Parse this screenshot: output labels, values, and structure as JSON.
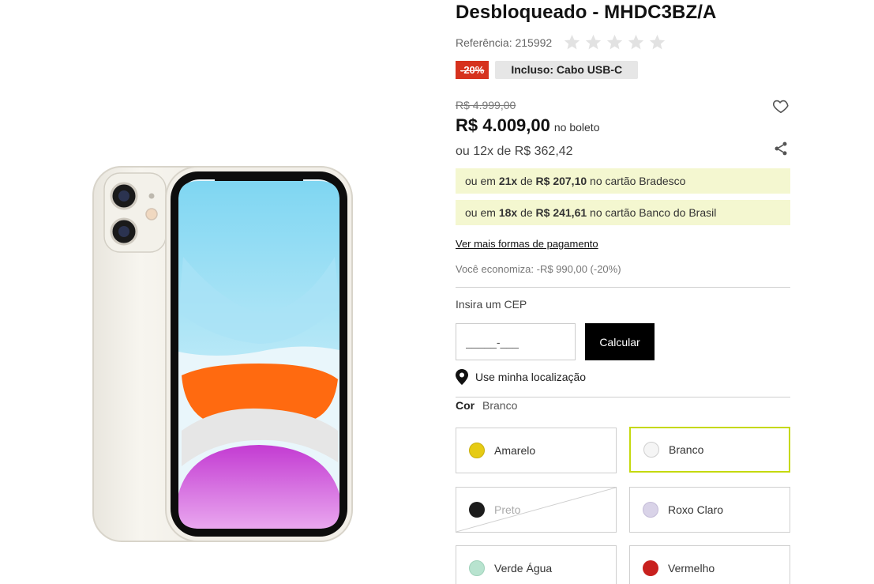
{
  "product": {
    "title": "Desbloqueado - MHDC3BZ/A",
    "reference": "Referência: 215992",
    "rating_stars": 5,
    "rating_filled": 0
  },
  "badges": {
    "discount": "-20%",
    "include": "Incluso: Cabo USB-C"
  },
  "price": {
    "old": "R$ 4.999,00",
    "current": "R$ 4.009,00",
    "current_suffix": "no boleto",
    "installments": "ou 12x de R$ 362,42"
  },
  "offers": [
    {
      "prefix": "ou em",
      "count": "21x",
      "mid": "de",
      "amount": "R$ 207,10",
      "suffix": "no cartão Bradesco"
    },
    {
      "prefix": "ou em",
      "count": "18x",
      "mid": "de",
      "amount": "R$ 241,61",
      "suffix": "no cartão Banco do Brasil"
    }
  ],
  "more_payment_link": "Ver mais formas de pagamento",
  "economy": "Você economiza: -R$ 990,00 (-20%)",
  "cep": {
    "label": "Insira um CEP",
    "placeholder": "_____-___",
    "button": "Calcular"
  },
  "location_text": "Use minha localização",
  "color": {
    "key": "Cor",
    "selected": "Branco",
    "options": [
      {
        "name": "Amarelo",
        "hex": "#e6cb14",
        "state": "available"
      },
      {
        "name": "Branco",
        "hex": "#f5f5f5",
        "state": "selected"
      },
      {
        "name": "Preto",
        "hex": "#1c1c1c",
        "state": "unavailable"
      },
      {
        "name": "Roxo Claro",
        "hex": "#d9d3e8",
        "state": "available"
      },
      {
        "name": "Verde Água",
        "hex": "#b8e3cf",
        "state": "available"
      },
      {
        "name": "Vermelho",
        "hex": "#c8201e",
        "state": "available"
      }
    ]
  },
  "colors": {
    "discount_badge": "#d6321e",
    "offer_bg": "#f4f7d0",
    "selected_border": "#c5d90e",
    "button_bg": "#000000"
  },
  "icons": [
    "star-icon",
    "heart-icon",
    "share-icon",
    "location-pin-icon"
  ]
}
